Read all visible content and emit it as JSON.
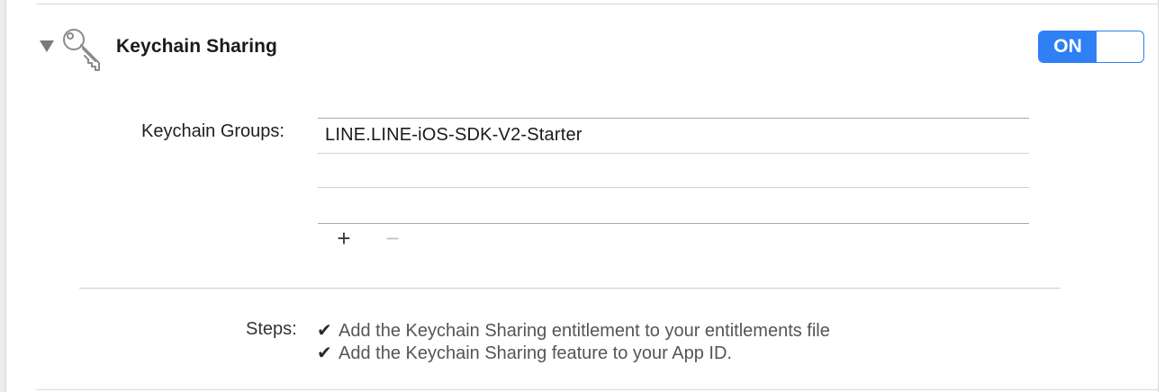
{
  "section": {
    "title": "Keychain Sharing",
    "toggle": {
      "on_label": "ON",
      "state": "on",
      "accent_color": "#2f7ff5"
    }
  },
  "keychain_groups": {
    "label": "Keychain Groups:",
    "items": [
      "LINE.LINE-iOS-SDK-V2-Starter"
    ],
    "add_label": "+",
    "remove_label": "−"
  },
  "steps": {
    "label": "Steps:",
    "check_glyph": "✔",
    "items": [
      "Add the Keychain Sharing entitlement to your entitlements file",
      "Add the Keychain Sharing feature to your App ID."
    ]
  },
  "icons": {
    "disclosure": "disclosure-triangle-down",
    "section_icon": "key-icon",
    "step_status": "checkmark-icon"
  }
}
